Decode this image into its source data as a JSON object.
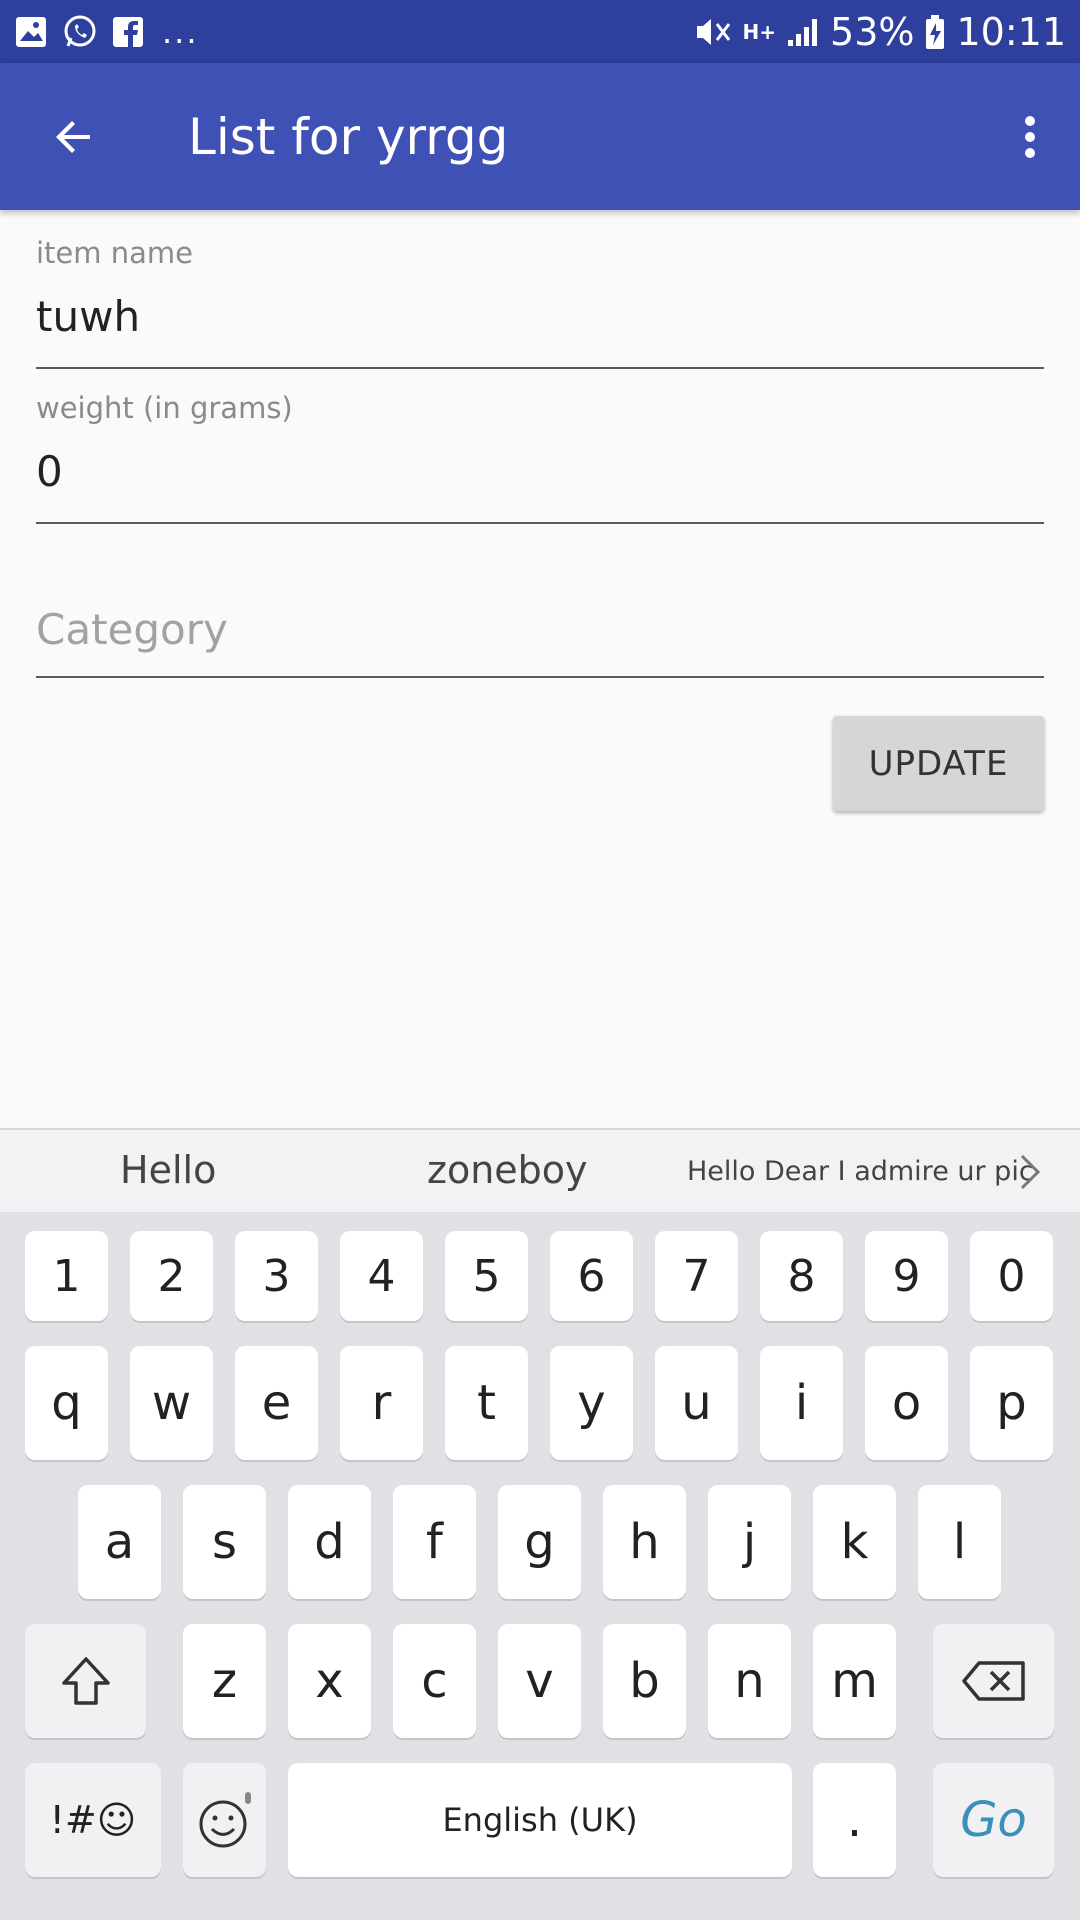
{
  "status_bar": {
    "battery": "53%",
    "time": "10:11",
    "left_icons": [
      "gallery-icon",
      "whatsapp-icon",
      "facebook-icon"
    ],
    "overflow": "...",
    "network": "H+"
  },
  "app_bar": {
    "title": "List for yrrgg",
    "color": "#3f51b5",
    "status_color": "#2e3f9e"
  },
  "form": {
    "item_name_label": "item name",
    "item_name_value": "tuwh",
    "weight_label": "weight (in grams)",
    "weight_value": "0",
    "category_placeholder": "Category",
    "update_button": "UPDATE"
  },
  "keyboard": {
    "suggestions": [
      "Hello",
      "zoneboy",
      "Hello Dear I admire ur pic"
    ],
    "row_numbers": [
      "1",
      "2",
      "3",
      "4",
      "5",
      "6",
      "7",
      "8",
      "9",
      "0"
    ],
    "row_1": [
      "q",
      "w",
      "e",
      "r",
      "t",
      "y",
      "u",
      "i",
      "o",
      "p"
    ],
    "row_2": [
      "a",
      "s",
      "d",
      "f",
      "g",
      "h",
      "j",
      "k",
      "l"
    ],
    "row_3": [
      "z",
      "x",
      "c",
      "v",
      "b",
      "n",
      "m"
    ],
    "symbols_key": "!#☺",
    "space_label": "English (UK)",
    "period_key": ".",
    "go_key": "Go",
    "go_color": "#3b8fb8"
  }
}
